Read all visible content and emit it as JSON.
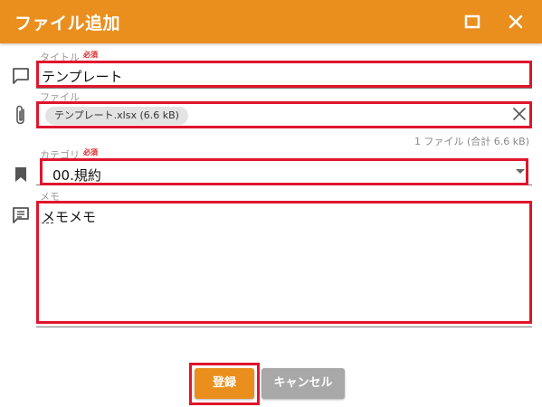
{
  "dialog": {
    "title": "ファイル追加",
    "accent_color": "#ea8f1e",
    "highlight_color": "#e0152d"
  },
  "fields": {
    "title": {
      "label": "タイトル",
      "required_mark": "必須",
      "value": "テンプレート",
      "icon": "comment-icon"
    },
    "file": {
      "label": "ファイル",
      "chip_text": "テンプレート.xlsx (6.6 kB)",
      "summary": "1 ファイル (合計 6.6 kB)",
      "icon": "paperclip-icon",
      "clear_icon": "close-icon"
    },
    "category": {
      "label": "カテゴリ",
      "required_mark": "必須",
      "value": "00.規約",
      "icon": "bookmark-icon"
    },
    "memo": {
      "label": "メモ",
      "value": "メモメモ",
      "icon": "message-icon"
    }
  },
  "buttons": {
    "register": "登録",
    "cancel": "キャンセル"
  }
}
